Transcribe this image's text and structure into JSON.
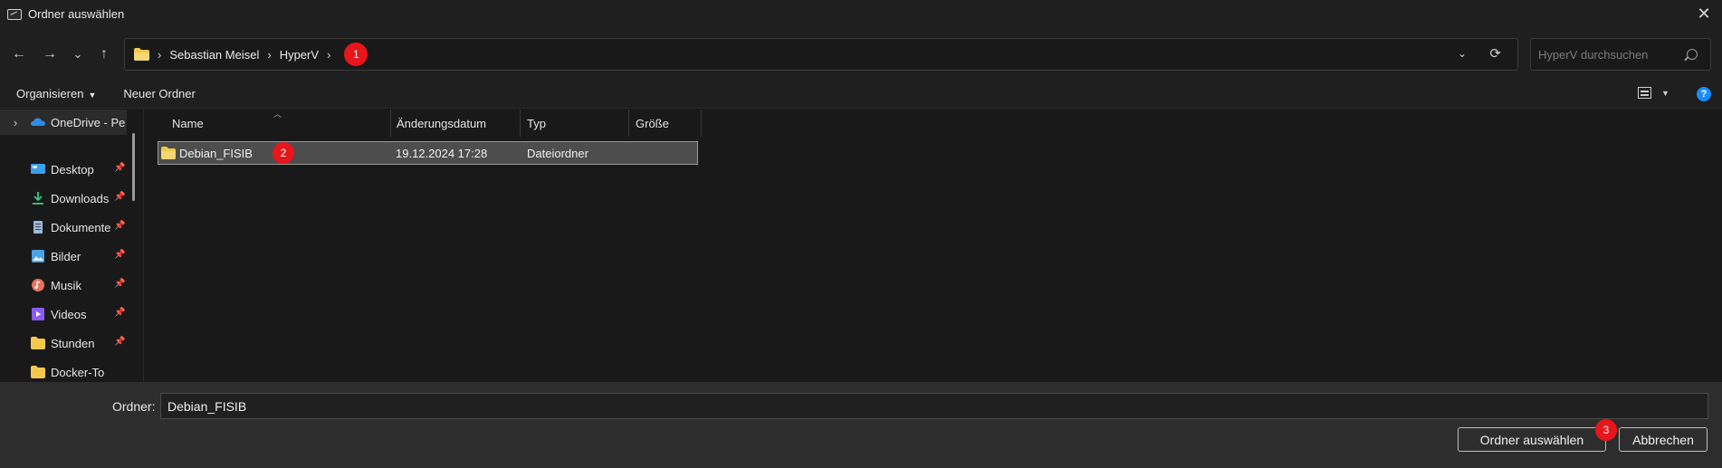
{
  "window": {
    "title": "Ordner auswählen",
    "close_glyph": "✕"
  },
  "nav": {
    "back_glyph": "←",
    "forward_glyph": "→",
    "recent_glyph": "⌄",
    "up_glyph": "↑",
    "breadcrumbs": [
      "Sebastian Meisel",
      "HyperV"
    ],
    "crumb_separator": "›",
    "refresh_glyph": "⟳",
    "dropdown_glyph": "⌄",
    "search_placeholder": "HyperV durchsuchen"
  },
  "toolbar": {
    "organize_label": "Organisieren",
    "new_folder_label": "Neuer Ordner",
    "help_glyph": "?"
  },
  "sidebar": {
    "items": [
      {
        "label": "OneDrive - Pe",
        "icon": "onedrive-icon",
        "pinned": false
      },
      {
        "label": "Desktop",
        "icon": "desktop-icon",
        "pinned": true
      },
      {
        "label": "Downloads",
        "icon": "download-icon",
        "pinned": true
      },
      {
        "label": "Dokumente",
        "icon": "document-icon",
        "pinned": true
      },
      {
        "label": "Bilder",
        "icon": "picture-icon",
        "pinned": true
      },
      {
        "label": "Musik",
        "icon": "music-icon",
        "pinned": true
      },
      {
        "label": "Videos",
        "icon": "video-icon",
        "pinned": true
      },
      {
        "label": "Stunden",
        "icon": "folder-icon",
        "pinned": true
      },
      {
        "label": "Docker-To",
        "icon": "folder-icon",
        "pinned": true
      }
    ]
  },
  "columns": [
    "Name",
    "Änderungsdatum",
    "Typ",
    "Größe"
  ],
  "files": [
    {
      "name": "Debian_FISIB",
      "modified": "19.12.2024 17:28",
      "type": "Dateiordner",
      "size": ""
    }
  ],
  "footer": {
    "folder_label": "Ordner:",
    "folder_value": "Debian_FISIB",
    "ok_label": "Ordner auswählen",
    "cancel_label": "Abbrechen"
  },
  "annotations": [
    "1",
    "2",
    "3"
  ],
  "colors": {
    "accent_blue": "#1a8cff",
    "badge_red": "#e8151b",
    "folder_yellow": "#f2c94c"
  }
}
